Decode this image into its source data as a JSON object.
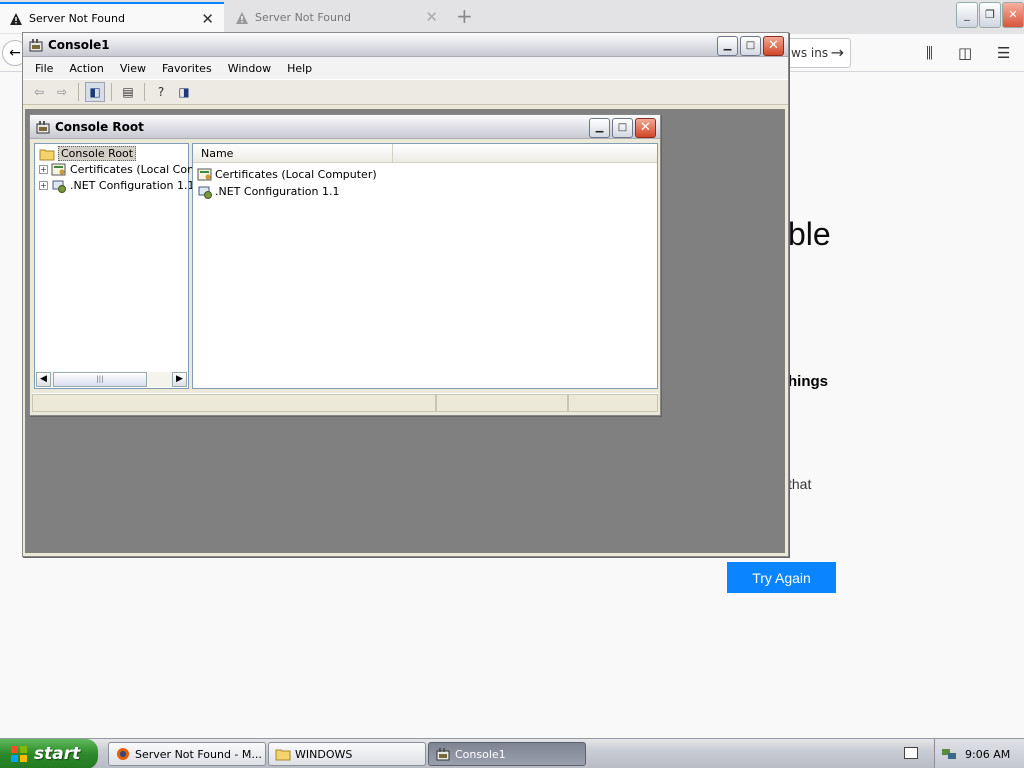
{
  "firefox": {
    "tabs": [
      {
        "title": "Server Not Found",
        "active": true
      },
      {
        "title": "Server Not Found",
        "active": false
      }
    ],
    "url_visible": "ws ins",
    "error": {
      "title_fragment": "ble",
      "heading_fragment": "hings",
      "text_fragment": "that"
    },
    "try_again": "Try Again"
  },
  "console_window": {
    "title": "Console1",
    "menu": [
      "File",
      "Action",
      "View",
      "Favorites",
      "Window",
      "Help"
    ]
  },
  "console_root_window": {
    "title": "Console Root",
    "tree": {
      "root": "Console Root",
      "items": [
        "Certificates (Local Com",
        ".NET Configuration 1.1"
      ]
    },
    "list": {
      "column": "Name",
      "items": [
        "Certificates (Local Computer)",
        ".NET Configuration 1.1"
      ]
    }
  },
  "taskbar": {
    "start": "start",
    "buttons": [
      {
        "label": "Server Not Found - M...",
        "icon": "firefox-icon"
      },
      {
        "label": "WINDOWS",
        "icon": "folder-icon"
      },
      {
        "label": "Console1",
        "icon": "mmc-icon"
      }
    ],
    "clock": "9:06 AM"
  }
}
